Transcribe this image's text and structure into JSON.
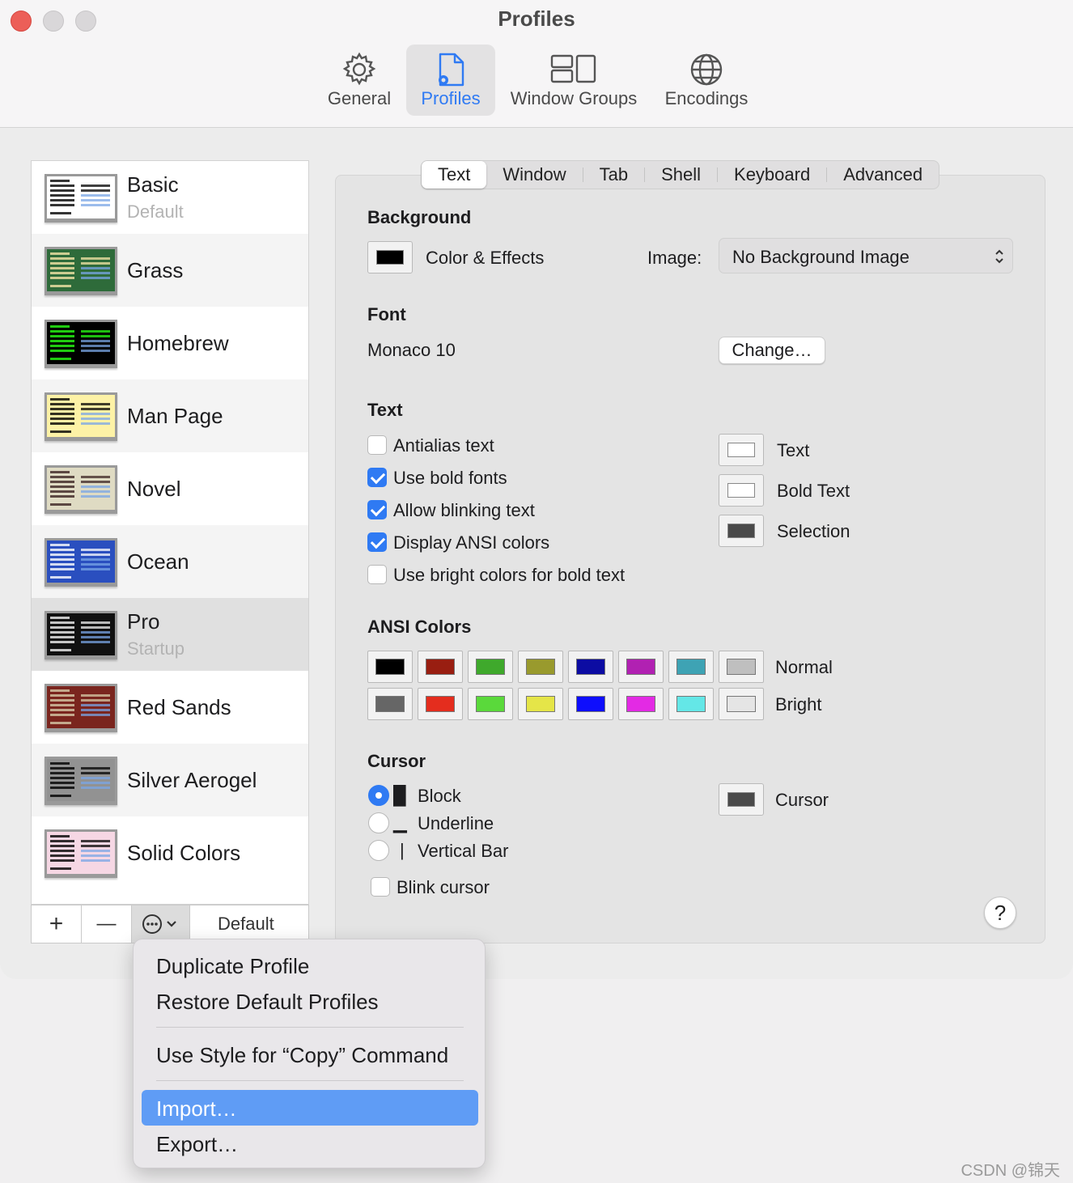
{
  "window": {
    "title": "Profiles"
  },
  "toolbar": [
    {
      "label": "General",
      "icon": "gear-icon"
    },
    {
      "label": "Profiles",
      "icon": "profile-doc-icon",
      "selected": true
    },
    {
      "label": "Window Groups",
      "icon": "window-groups-icon"
    },
    {
      "label": "Encodings",
      "icon": "globe-icon"
    }
  ],
  "profiles": [
    {
      "name": "Basic",
      "sub": "Default",
      "bg": "#ffffff",
      "fg": "#000000"
    },
    {
      "name": "Grass",
      "sub": "",
      "bg": "#2e6b3a",
      "fg": "#f5e6a8"
    },
    {
      "name": "Homebrew",
      "sub": "",
      "bg": "#000000",
      "fg": "#28fe14"
    },
    {
      "name": "Man Page",
      "sub": "",
      "bg": "#fdf2a6",
      "fg": "#000000"
    },
    {
      "name": "Novel",
      "sub": "",
      "bg": "#dfdbc3",
      "fg": "#3b2322"
    },
    {
      "name": "Ocean",
      "sub": "",
      "bg": "#2a4fbf",
      "fg": "#ffffff"
    },
    {
      "name": "Pro",
      "sub": "Startup",
      "bg": "#111111",
      "fg": "#f2f2f2"
    },
    {
      "name": "Red Sands",
      "sub": "",
      "bg": "#7a251e",
      "fg": "#d7c9a7"
    },
    {
      "name": "Silver Aerogel",
      "sub": "",
      "bg": "#929292",
      "fg": "#000000"
    },
    {
      "name": "Solid Colors",
      "sub": "",
      "bg": "#f6d7e4",
      "fg": "#000000"
    }
  ],
  "list_toolbar": {
    "add": "+",
    "remove": "—",
    "default_label": "Default"
  },
  "tabs": [
    "Text",
    "Window",
    "Tab",
    "Shell",
    "Keyboard",
    "Advanced"
  ],
  "background": {
    "heading": "Background",
    "color_label": "Color & Effects",
    "image_label": "Image:",
    "image_value": "No Background Image"
  },
  "font": {
    "heading": "Font",
    "value": "Monaco 10",
    "change_button": "Change…"
  },
  "text": {
    "heading": "Text",
    "options": [
      {
        "label": "Antialias text",
        "checked": false
      },
      {
        "label": "Use bold fonts",
        "checked": true
      },
      {
        "label": "Allow blinking text",
        "checked": true
      },
      {
        "label": "Display ANSI colors",
        "checked": true
      },
      {
        "label": "Use bright colors for bold text",
        "checked": false
      }
    ],
    "colors": [
      {
        "label": "Text",
        "color": "#ffffff"
      },
      {
        "label": "Bold Text",
        "color": "#ffffff"
      },
      {
        "label": "Selection",
        "color": "#4a4a4a"
      }
    ]
  },
  "ansi": {
    "heading": "ANSI Colors",
    "normal_label": "Normal",
    "bright_label": "Bright",
    "normal": [
      "#000000",
      "#991e11",
      "#3fa92c",
      "#999a2d",
      "#0c0ca3",
      "#b121b2",
      "#3ea3b4",
      "#bfbfbf"
    ],
    "bright": [
      "#666666",
      "#e42d1e",
      "#5ad93b",
      "#e5e548",
      "#0e0efd",
      "#e32ae4",
      "#64e7e7",
      "#e5e5e5"
    ]
  },
  "cursor": {
    "heading": "Cursor",
    "options": [
      {
        "label": "Block",
        "selected": true,
        "glyph": "█"
      },
      {
        "label": "Underline",
        "selected": false,
        "glyph": "▁"
      },
      {
        "label": "Vertical Bar",
        "selected": false,
        "glyph": "|"
      }
    ],
    "blink_label": "Blink cursor",
    "color_label": "Cursor",
    "color": "#4a4a4a"
  },
  "help": "?",
  "menu": {
    "items": [
      "Duplicate Profile",
      "Restore Default Profiles",
      "Use Style for “Copy” Command",
      "Import…",
      "Export…"
    ],
    "highlighted": "Import…"
  },
  "watermark": "CSDN @锦天"
}
